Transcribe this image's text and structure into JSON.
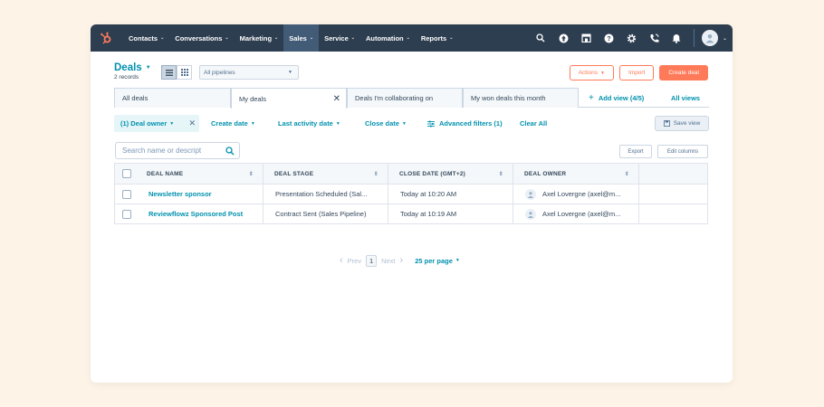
{
  "nav": {
    "items": [
      {
        "label": "Contacts"
      },
      {
        "label": "Conversations"
      },
      {
        "label": "Marketing"
      },
      {
        "label": "Sales"
      },
      {
        "label": "Service"
      },
      {
        "label": "Automation"
      },
      {
        "label": "Reports"
      }
    ],
    "active": "Sales",
    "icons": [
      "search-icon",
      "upgrade-icon",
      "marketplace-icon",
      "help-icon",
      "settings-icon",
      "calling-icon",
      "notifications-icon"
    ]
  },
  "header": {
    "title": "Deals",
    "records": "2 records",
    "pipeline": "All pipelines"
  },
  "buttons": {
    "actions": "Actions",
    "import": "Import",
    "create": "Create deal",
    "save_view": "Save view",
    "export": "Export",
    "edit_columns": "Edit columns"
  },
  "tabs": [
    {
      "label": "All deals"
    },
    {
      "label": "My deals"
    },
    {
      "label": "Deals I'm collaborating on"
    },
    {
      "label": "My won deals this month"
    }
  ],
  "add_view": "Add view (4/5)",
  "all_views": "All views",
  "filters": {
    "deal_owner": "(1) Deal owner",
    "create_date": "Create date",
    "last_activity": "Last activity date",
    "close_date": "Close date",
    "advanced": "Advanced filters (1)",
    "clear_all": "Clear All"
  },
  "search": {
    "placeholder": "Search name or descript"
  },
  "table": {
    "headers": [
      "DEAL NAME",
      "DEAL STAGE",
      "CLOSE DATE (GMT+2)",
      "DEAL OWNER"
    ],
    "rows": [
      {
        "name": "Newsletter sponsor",
        "stage": "Presentation Scheduled (Sal...",
        "close": "Today at 10:20 AM",
        "owner": "Axel Lovergne (axel@m..."
      },
      {
        "name": "Reviewflowz Sponsored Post",
        "stage": "Contract Sent (Sales Pipeline)",
        "close": "Today at 10:19 AM",
        "owner": "Axel Lovergne (axel@m..."
      }
    ]
  },
  "pagination": {
    "prev": "Prev",
    "page": "1",
    "next": "Next",
    "per_page": "25 per page"
  },
  "colors": {
    "nav_bg": "#2d3e50",
    "accent": "#0091ae",
    "primary": "#ff7a59",
    "background": "#fdf3e7"
  }
}
